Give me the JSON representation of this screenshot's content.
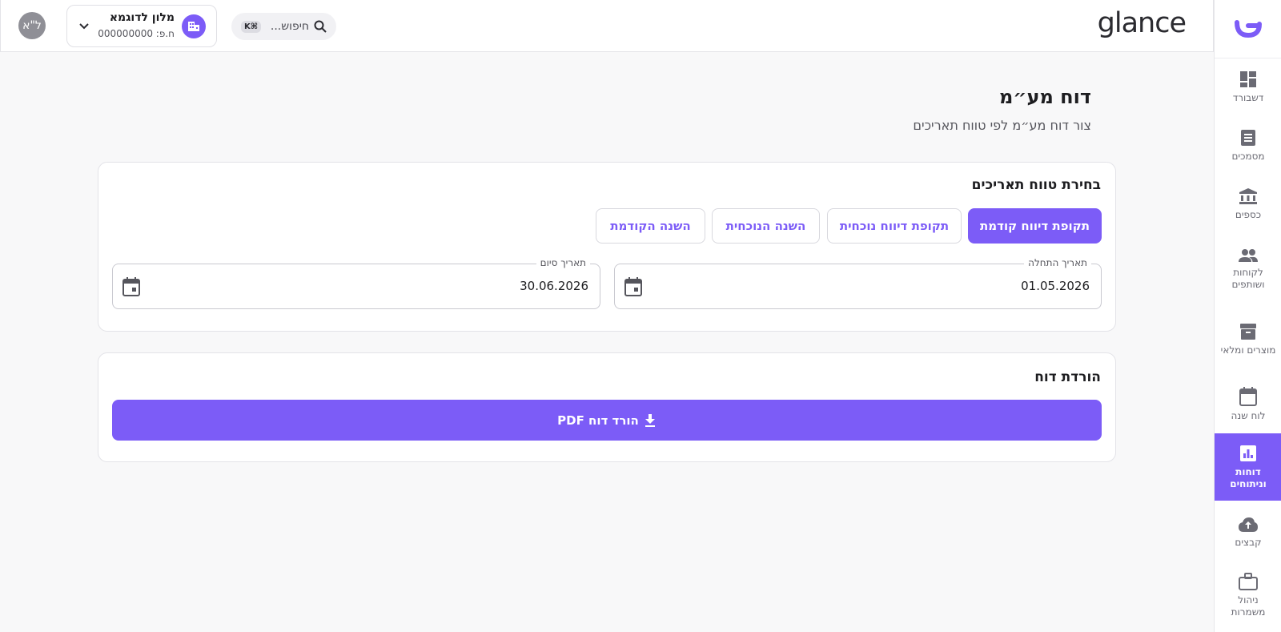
{
  "app": {
    "brand": "glance"
  },
  "header": {
    "avatar_initials": "ל\"א",
    "company_name": "מלון לדוגמא",
    "company_id": "ח.פ: 000000000",
    "search_placeholder": "חיפוש...",
    "search_shortcut": "K⌘"
  },
  "sidebar": {
    "items": [
      {
        "label": "דשבורד",
        "icon": "dashboard-icon"
      },
      {
        "label": "מסמכים",
        "icon": "document-icon"
      },
      {
        "label": "כספים",
        "icon": "bank-icon"
      },
      {
        "label": "לקוחות ושותפים",
        "icon": "people-icon"
      },
      {
        "label": "מוצרים ומלאי",
        "icon": "archive-icon"
      },
      {
        "label": "לוח שנה",
        "icon": "calendar-icon"
      },
      {
        "label": "דוחות וניתוחים",
        "icon": "chart-icon",
        "active": true
      },
      {
        "label": "קבצים",
        "icon": "cloud-upload-icon"
      },
      {
        "label": "ניהול משמרות",
        "icon": "briefcase-icon"
      }
    ]
  },
  "page": {
    "title": "דוח מע״מ",
    "subtitle": "צור דוח מע״מ לפי טווח תאריכים"
  },
  "date_range": {
    "title": "בחירת טווח תאריכים",
    "presets": [
      {
        "label": "תקופת דיווח קודמת",
        "active": true
      },
      {
        "label": "תקופת דיווח נוכחית"
      },
      {
        "label": "השנה הנוכחית"
      },
      {
        "label": "השנה הקודמת"
      }
    ],
    "start": {
      "label": "תאריך התחלה",
      "value": "01.05.2026"
    },
    "end": {
      "label": "תאריך סיום",
      "value": "30.06.2026"
    }
  },
  "download": {
    "title": "הורדת דוח",
    "button_label": "הורד דוח PDF"
  },
  "colors": {
    "accent": "#7c5cf7",
    "background": "#f8f8f9"
  }
}
